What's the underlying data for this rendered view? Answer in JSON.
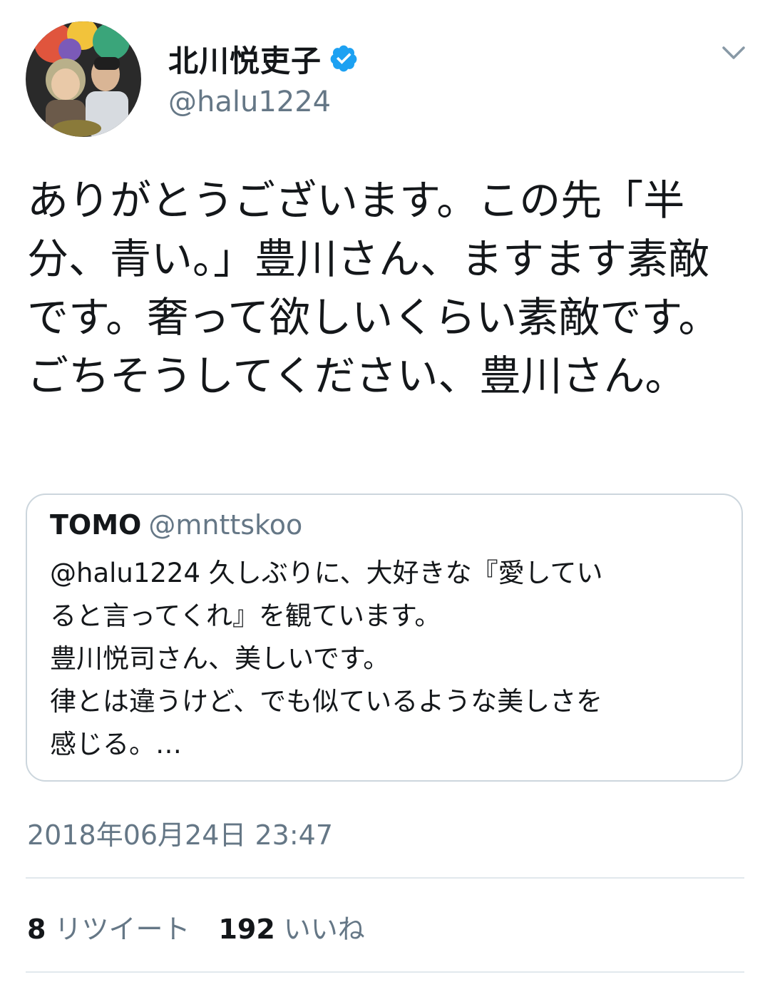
{
  "author": {
    "display_name": "北川悦吏子",
    "handle": "@halu1224",
    "verified": true,
    "avatar_icon": "profile-photo"
  },
  "tweet": {
    "text": "ありがとうございます。この先「半分、青い。」豊川さん、ますます素敵です。奢って欲しいくらい素敵です。ごちそうしてください、豊川さん。"
  },
  "quoted_tweet": {
    "name": "TOMO",
    "handle": "@mnttskoo",
    "text": "@halu1224 久しぶりに、大好きな『愛してい\nると言ってくれ』を観ています。\n豊川悦司さん、美しいです。\n律とは違うけど、でも似ているような美しさを\n感じる。…"
  },
  "timestamp": "2018年06月24日 23:47",
  "stats": {
    "retweets_count": "8",
    "retweets_label": "リツイート",
    "likes_count": "192",
    "likes_label": "いいね"
  },
  "colors": {
    "primary_text": "#14171a",
    "secondary_text": "#657786",
    "verified_blue": "#1da1f2",
    "border": "#ccd6dd",
    "divider": "#e1e8ed"
  }
}
